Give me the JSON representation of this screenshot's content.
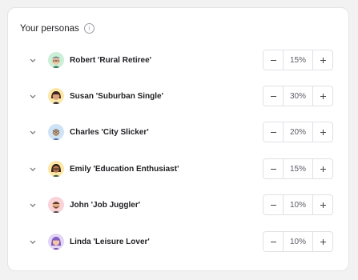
{
  "header": {
    "title": "Your personas",
    "info_glyph": "i"
  },
  "personas": [
    {
      "name": "Robert 'Rural Retiree'",
      "percent": "15%",
      "avatar_bg": "#c9efd7",
      "icon": "man-glasses-avatar-icon"
    },
    {
      "name": "Susan 'Suburban Single'",
      "percent": "30%",
      "avatar_bg": "#fde7a8",
      "icon": "woman-dark-hair-avatar-icon"
    },
    {
      "name": "Charles 'City Slicker'",
      "percent": "20%",
      "avatar_bg": "#cfe3f7",
      "icon": "man-beard-glasses-avatar-icon"
    },
    {
      "name": "Emily 'Education Enthusiast'",
      "percent": "15%",
      "avatar_bg": "#fde7a8",
      "icon": "woman-glasses-avatar-icon"
    },
    {
      "name": "John 'Job Juggler'",
      "percent": "10%",
      "avatar_bg": "#f9d3d8",
      "icon": "man-beard-avatar-icon"
    },
    {
      "name": "Linda 'Leisure Lover'",
      "percent": "10%",
      "avatar_bg": "#e3d6f5",
      "icon": "woman-purple-hair-avatar-icon"
    }
  ]
}
